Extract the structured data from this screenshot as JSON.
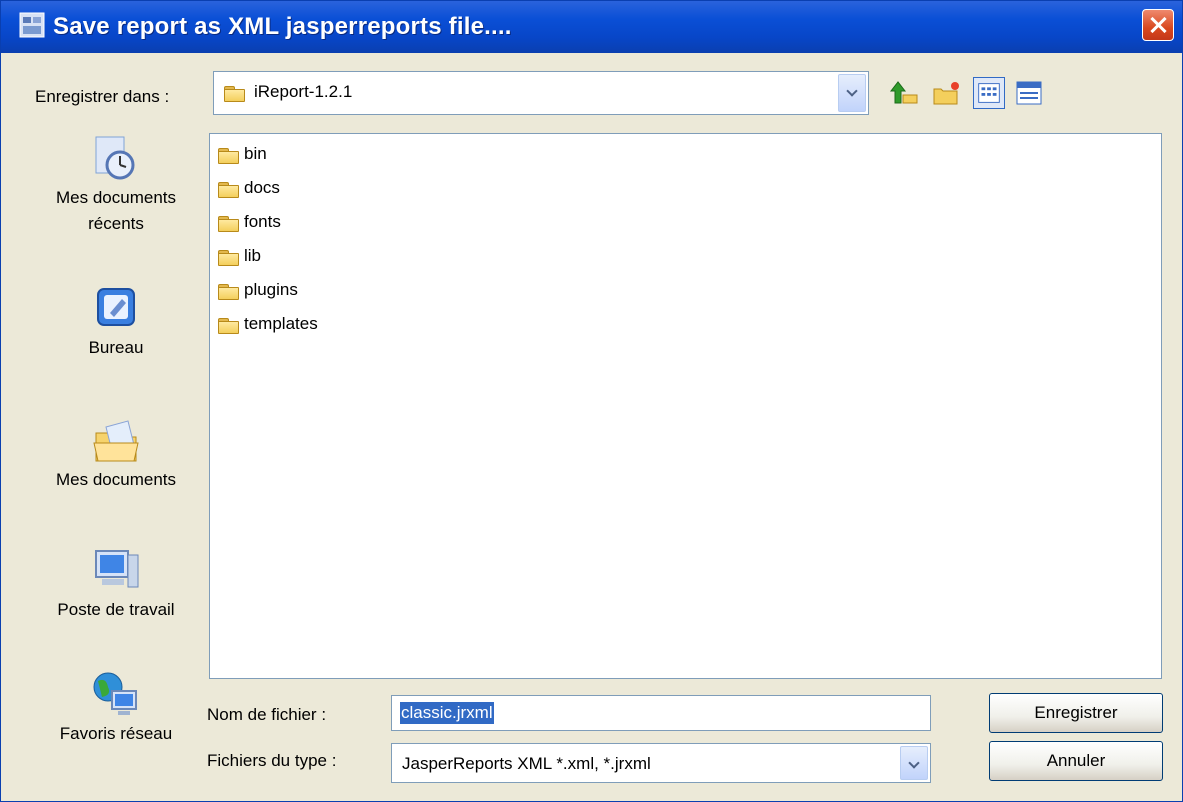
{
  "dialog": {
    "title": "Save report as XML jasperreports file....",
    "icons": {
      "app": "jasper-app-icon",
      "close": "close-icon"
    },
    "accent_color": "#0a4fd6"
  },
  "location": {
    "label": "Enregistrer dans :",
    "value": "iReport-1.2.1",
    "icon": "folder-icon"
  },
  "toolbar": {
    "items": [
      {
        "icon": "up-folder-icon"
      },
      {
        "icon": "new-folder-icon"
      },
      {
        "icon": "list-view-icon"
      },
      {
        "icon": "details-view-icon"
      }
    ]
  },
  "places": {
    "items": [
      {
        "label": "Mes documents récents",
        "icon": "recent-documents-icon"
      },
      {
        "label": "Bureau",
        "icon": "desktop-icon"
      },
      {
        "label": "Mes documents",
        "icon": "my-documents-icon"
      },
      {
        "label": "Poste de travail",
        "icon": "my-computer-icon"
      },
      {
        "label": "Favoris réseau",
        "icon": "network-places-icon"
      }
    ]
  },
  "files": [
    {
      "name": "bin",
      "icon": "folder-icon"
    },
    {
      "name": "docs",
      "icon": "folder-icon"
    },
    {
      "name": "fonts",
      "icon": "folder-icon"
    },
    {
      "name": "lib",
      "icon": "folder-icon"
    },
    {
      "name": "plugins",
      "icon": "folder-icon"
    },
    {
      "name": "templates",
      "icon": "folder-icon"
    }
  ],
  "filename": {
    "label": "Nom de fichier :",
    "value": "classic.jrxml"
  },
  "filetype": {
    "label": "Fichiers du type :",
    "value": "JasperReports XML *.xml, *.jrxml"
  },
  "buttons": {
    "save": "Enregistrer",
    "cancel": "Annuler"
  }
}
